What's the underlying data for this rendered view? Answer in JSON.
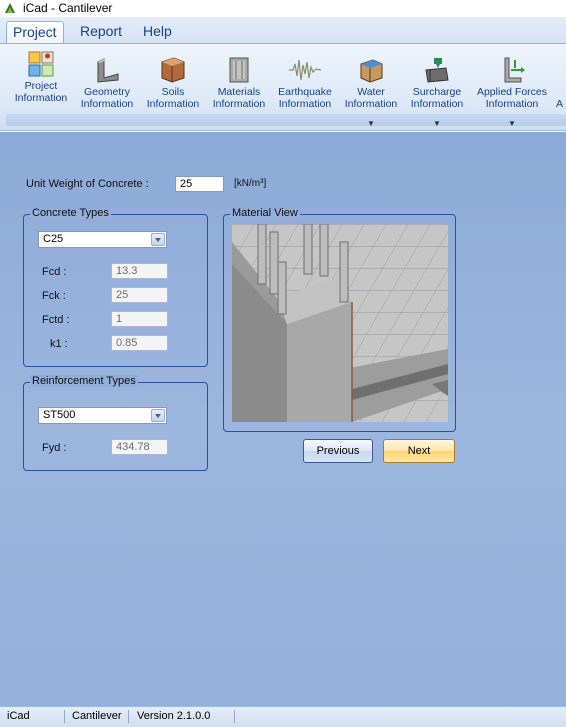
{
  "window": {
    "title": "iCad - Cantilever"
  },
  "menu": {
    "tabs": [
      {
        "label": "Project"
      },
      {
        "label": "Report"
      },
      {
        "label": "Help"
      }
    ]
  },
  "ribbon": {
    "buttons": [
      {
        "line1": "Project",
        "line2": "Information",
        "icon": "project-info-icon"
      },
      {
        "line1": "Geometry",
        "line2": "Information",
        "icon": "geometry-icon"
      },
      {
        "line1": "Soils",
        "line2": "Information",
        "icon": "soils-icon"
      },
      {
        "line1": "Materials",
        "line2": "Information",
        "icon": "materials-icon"
      },
      {
        "line1": "Earthquake",
        "line2": "Information",
        "icon": "earthquake-icon"
      },
      {
        "line1": "Water",
        "line2": "Information",
        "icon": "water-icon"
      },
      {
        "line1": "Surcharge",
        "line2": "Information",
        "icon": "surcharge-icon"
      },
      {
        "line1": "Applied Forces",
        "line2": "Information",
        "icon": "applied-forces-icon"
      },
      {
        "line1": "A",
        "line2": "",
        "icon": ""
      }
    ]
  },
  "form": {
    "unit_weight": {
      "label": "Unit Weight of Concrete :",
      "value": "25",
      "unit": "[kN/m³]"
    },
    "concrete_types": {
      "legend": "Concrete Types",
      "selected": "C25",
      "fields": [
        {
          "label": "Fcd :",
          "value": "13.3"
        },
        {
          "label": "Fck :",
          "value": "25"
        },
        {
          "label": "Fctd :",
          "value": "1"
        },
        {
          "label": "k1 :",
          "value": "0.85"
        }
      ]
    },
    "reinforcement_types": {
      "legend": "Reinforcement Types",
      "selected": "ST500",
      "fields": [
        {
          "label": "Fyd :",
          "value": "434.78"
        }
      ]
    },
    "material_view": {
      "legend": "Material View"
    },
    "buttons": {
      "previous": "Previous",
      "next": "Next"
    }
  },
  "statusbar": {
    "app": "iCad",
    "project": "Cantilever",
    "version": "Version 2.1.0.0"
  }
}
